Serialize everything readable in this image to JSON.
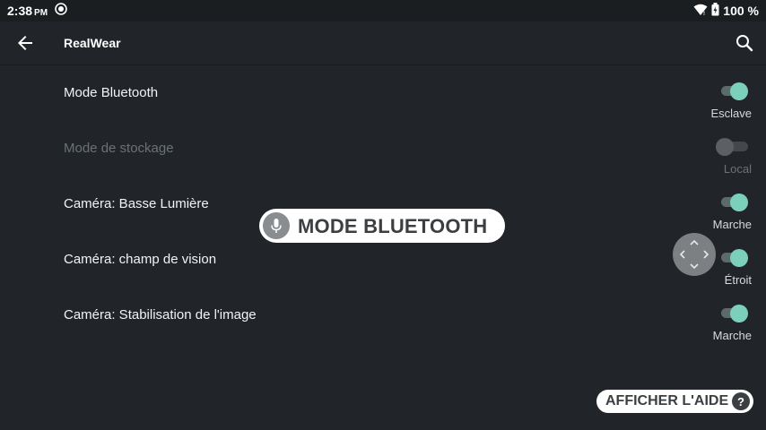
{
  "status_bar": {
    "time": "2:38",
    "ampm": "PM",
    "battery": "100 %"
  },
  "toolbar": {
    "title": "RealWear"
  },
  "settings": [
    {
      "label": "Mode Bluetooth",
      "value": "Esclave",
      "enabled": true,
      "on": true
    },
    {
      "label": "Mode de stockage",
      "value": "Local",
      "enabled": false,
      "on": false
    },
    {
      "label": "Caméra: Basse Lumière",
      "value": "Marche",
      "enabled": true,
      "on": true
    },
    {
      "label": "Caméra: champ de vision",
      "value": "Étroit",
      "enabled": true,
      "on": true
    },
    {
      "label": "Caméra: Stabilisation de l'image",
      "value": "Marche",
      "enabled": true,
      "on": true
    }
  ],
  "voice_command": {
    "text": "MODE BLUETOOTH"
  },
  "help": {
    "label": "AFFICHER L'AIDE",
    "icon_text": "?"
  },
  "colors": {
    "background": "#212529",
    "accent": "#7ccfbb"
  },
  "icons": {
    "back": "arrow-left-icon",
    "search": "search-icon",
    "mic": "microphone-icon",
    "wifi": "wifi-icon",
    "battery": "battery-icon",
    "notification": "notification-icon"
  }
}
